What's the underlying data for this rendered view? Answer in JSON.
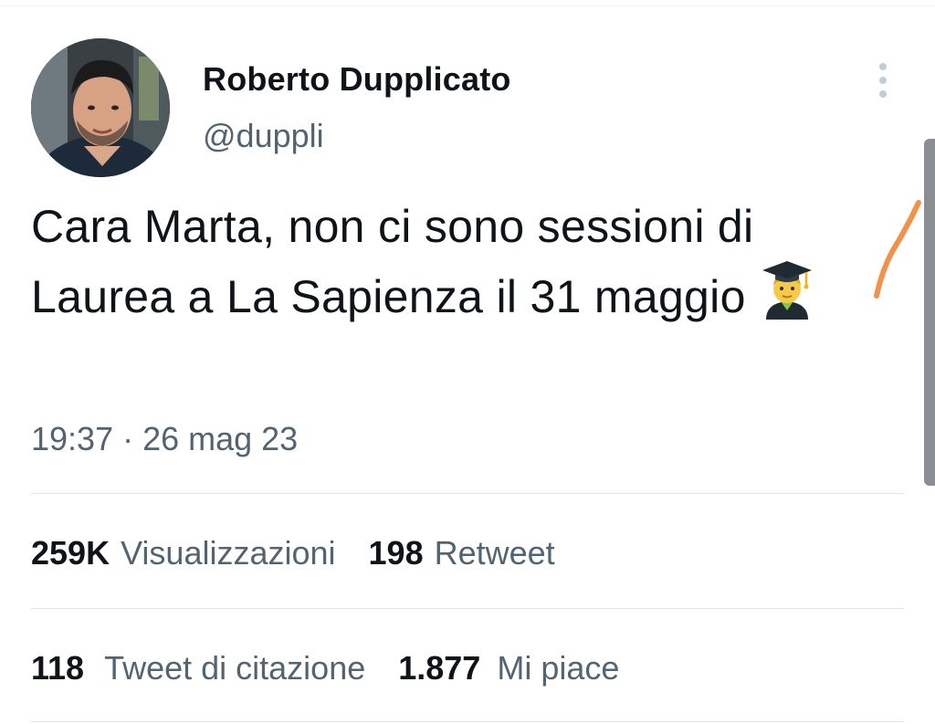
{
  "tweet": {
    "author_name": "Roberto Dupplicato",
    "author_handle": "@duppli",
    "text": "Cara Marta, non ci sono sessioni di Laurea a La Sapienza il 31 maggio",
    "emoji": "graduate-emoji",
    "timestamp": "19:37 · 26 mag 23"
  },
  "stats": {
    "views": {
      "count": "259K",
      "label": "Visualizzazioni"
    },
    "retweets": {
      "count": "198",
      "label": "Retweet"
    },
    "quotes": {
      "count": "118",
      "label": "Tweet di citazione"
    },
    "likes": {
      "count": "1.877",
      "label": "Mi piace"
    }
  },
  "icons": {
    "more": "more-vertical-icon"
  },
  "colors": {
    "text": "#0f1419",
    "secondary": "#536471",
    "divider": "#e1e6ea",
    "annotation": "#f0924a"
  }
}
